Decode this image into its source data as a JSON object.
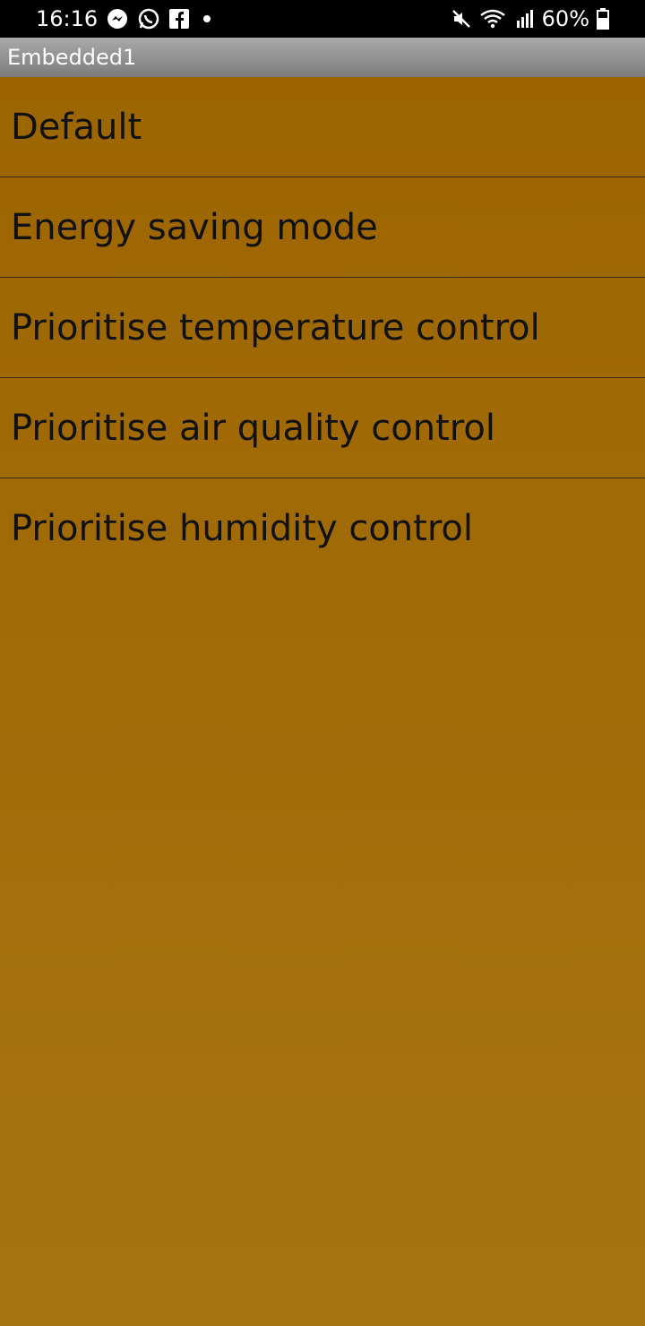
{
  "status_bar": {
    "time": "16:16",
    "battery": "60%",
    "icons_left": [
      "messenger-icon",
      "whatsapp-icon",
      "facebook-icon",
      "notification-dot"
    ],
    "icons_right": [
      "mute-icon",
      "wifi-icon",
      "signal-icon",
      "battery-icon"
    ]
  },
  "title_bar": {
    "title": "Embedded1"
  },
  "list": {
    "items": [
      {
        "label": "Default"
      },
      {
        "label": "Energy saving mode"
      },
      {
        "label": "Prioritise temperature control"
      },
      {
        "label": "Prioritise air quality control"
      },
      {
        "label": "Prioritise humidity control"
      }
    ]
  },
  "colors": {
    "background_top": "#9c6500",
    "background_bottom": "#a87412",
    "title_bar": "#8f8f8f",
    "text": "#111111"
  }
}
